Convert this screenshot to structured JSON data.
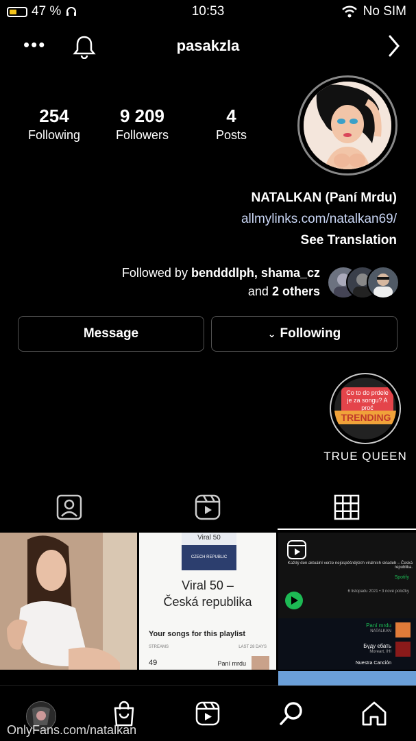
{
  "status_bar": {
    "battery_level": 0.47,
    "battery_text": "47 %",
    "time": "10:53",
    "carrier": "No SIM"
  },
  "header": {
    "username": "pasakzla"
  },
  "stats": [
    {
      "value": "4",
      "label": "Posts"
    },
    {
      "value": "9 209",
      "label": "Followers"
    },
    {
      "value": "254",
      "label": "Following"
    }
  ],
  "bio": {
    "name": "NATALKAN (Paní Mrdu)",
    "link": "allmylinks.com/natalkan69/",
    "translate": "See Translation"
  },
  "followed_by": {
    "prefix": "Followed by",
    "names": "bendddlph, shama_cz",
    "middle": "and",
    "others": "2 others"
  },
  "buttons": {
    "following": "Following",
    "message": "Message"
  },
  "highlight": {
    "label": "TRUE QUEEN",
    "sticker_text": "Co to do prdele je za songu? A proč",
    "banner": "TRENDING"
  },
  "posts": {
    "tile2": {
      "tag": "Viral 50",
      "country": "CZECH REPUBLIC",
      "title_line1": "Viral 50 –",
      "title_line2": "Česká republika",
      "subtitle": "Your songs for this playlist",
      "col_left": "LAST 28 DAYS",
      "col_right": "STREAMS",
      "row_song": "Paní mrdu",
      "row_value": "49"
    },
    "tile3": {
      "desc": "Každý den aktuální verze nejúspěšnějších virálních skladeb – Česká republika.",
      "brand": "Spotify",
      "meta": "6 listopadu 2021 • 3 nové položky",
      "track1": "Paní mrdu",
      "artist1": "NATALKAN",
      "track2": "Бүду єбать",
      "artist2": "Moreart, IHI",
      "track3": "Nuestra Canción"
    }
  },
  "watermark": "OnlyFans.com/natalkan",
  "colors": {
    "background": "#000000",
    "battery": "#f2c21b",
    "spotify": "#1db954",
    "trending": "#f0a23a"
  }
}
